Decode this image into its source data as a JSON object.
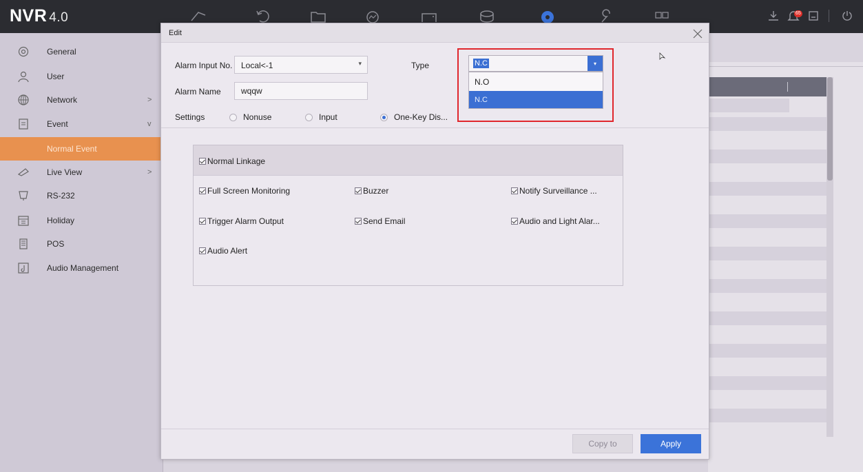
{
  "app": {
    "logo": "NVR",
    "version": "4.0",
    "notification_count": "65"
  },
  "topbar": {
    "icons": [
      "live-view-icon",
      "playback-icon",
      "file-icon",
      "smart-icon",
      "config-icon",
      "storage-icon",
      "settings-gear-icon",
      "maintenance-icon",
      "layout-icon"
    ],
    "right_icons": [
      "download-icon",
      "bell-icon",
      "lock-icon",
      "power-icon"
    ]
  },
  "sidebar": {
    "items": [
      {
        "label": "General",
        "icon": "gear-icon"
      },
      {
        "label": "User",
        "icon": "user-icon"
      },
      {
        "label": "Network",
        "icon": "globe-icon",
        "arrow": ">"
      },
      {
        "label": "Event",
        "icon": "event-icon",
        "arrow": "v"
      },
      {
        "label": "Normal Event",
        "sub": true
      },
      {
        "label": "Live View",
        "icon": "camera-icon",
        "arrow": ">"
      },
      {
        "label": "RS-232",
        "icon": "serial-icon"
      },
      {
        "label": "Holiday",
        "icon": "calendar-icon"
      },
      {
        "label": "POS",
        "icon": "pos-icon"
      },
      {
        "label": "Audio Management",
        "icon": "audio-icon"
      }
    ]
  },
  "modal": {
    "title": "Edit",
    "alarm_input_label": "Alarm Input No.",
    "alarm_input_value": "Local<-1",
    "alarm_name_label": "Alarm Name",
    "alarm_name_value": "wqqw",
    "type_label": "Type",
    "type_value": "N.C",
    "type_options": [
      "N.O",
      "N.C"
    ],
    "settings_label": "Settings",
    "settings_options": [
      {
        "label": "Nonuse",
        "checked": false
      },
      {
        "label": "Input",
        "checked": false
      },
      {
        "label": "One-Key Dis...",
        "checked": true
      }
    ],
    "linkage": {
      "header": "Normal Linkage",
      "items": [
        "Full Screen Monitoring",
        "Buzzer",
        "Notify Surveillance ...",
        "Trigger Alarm Output",
        "Send Email",
        "Audio and Light Alar...",
        "Audio Alert"
      ]
    },
    "buttons": {
      "copy": "Copy to",
      "apply": "Apply"
    }
  },
  "colors": {
    "accent": "#3b6fd3",
    "highlight": "#e0262c",
    "selected_nav": "#e8914f"
  }
}
